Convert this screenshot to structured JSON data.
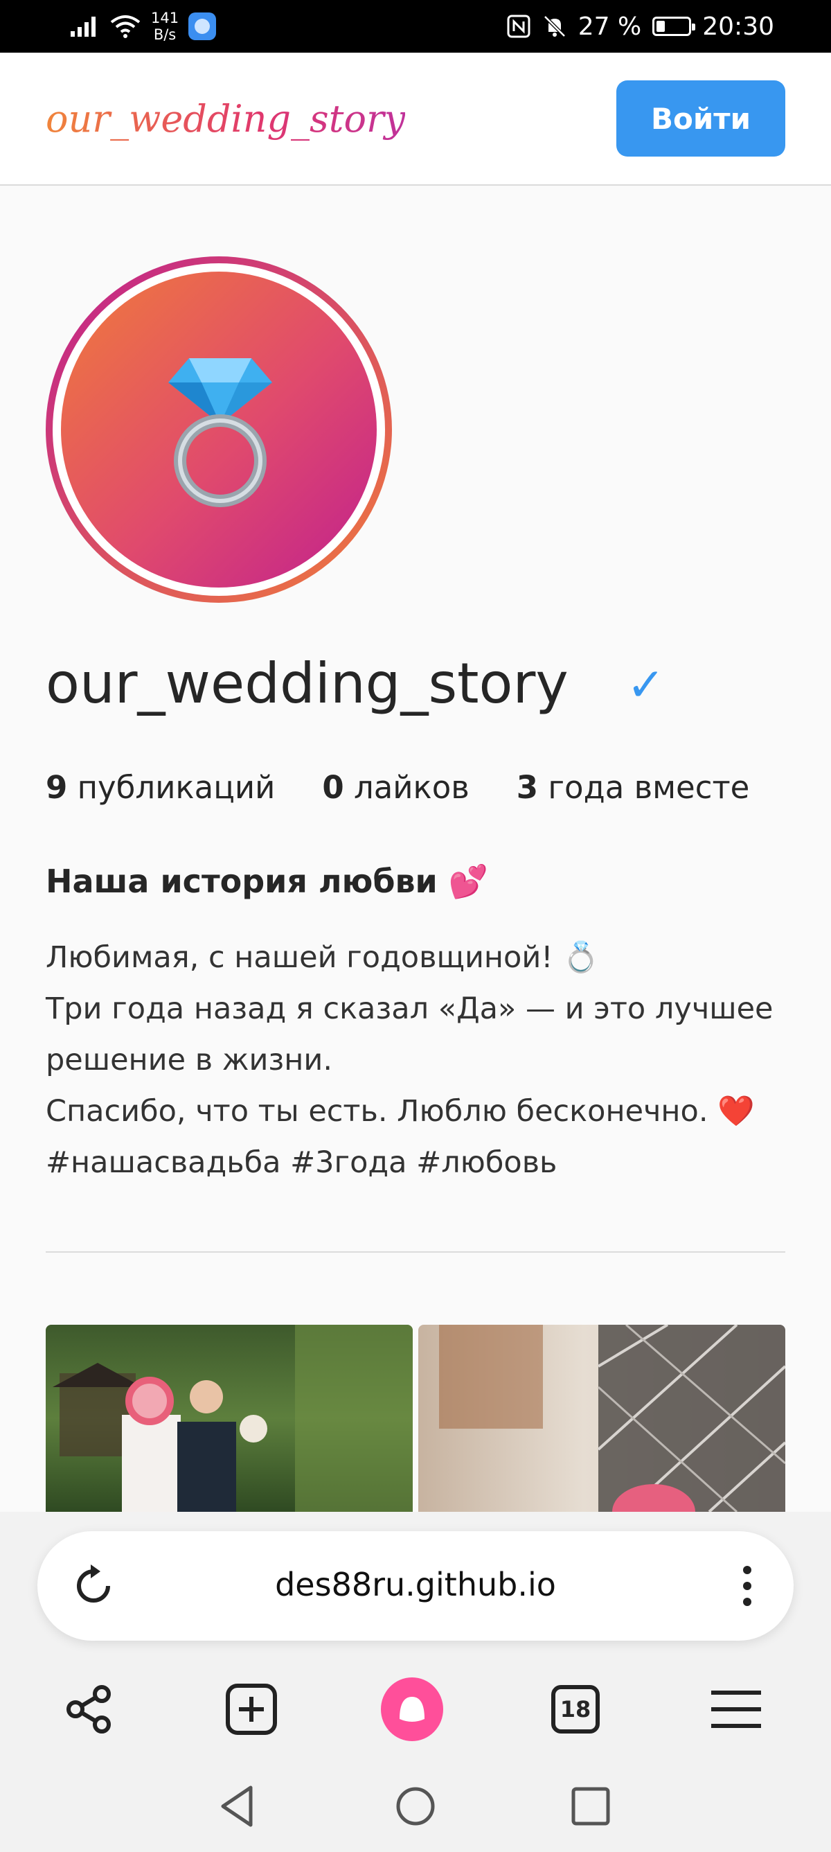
{
  "status_bar": {
    "net_speed_value": "141",
    "net_speed_unit": "B/s",
    "battery": "27 %",
    "battery_level": 0.27,
    "time": "20:30"
  },
  "header": {
    "logo": "our_wedding_story",
    "login_label": "Войти"
  },
  "profile": {
    "username": "our_wedding_story",
    "verified_mark": "✓",
    "stats": [
      {
        "value": "9",
        "label": "публикаций"
      },
      {
        "value": "0",
        "label": "лайков"
      },
      {
        "value": "3",
        "label": "года вместе"
      }
    ],
    "bio_title": "Наша история любви 💕",
    "bio_lines": [
      "Любимая, с нашей годовщиной! 💍",
      "Три года назад я сказал «Да» — и это лучшее",
      "решение в жизни.",
      "Спасибо, что ты есть. Люблю бесконечно. ❤️",
      "#нашасвадьба #3года #любовь"
    ]
  },
  "browser": {
    "url": "des88ru.github.io",
    "tabs_count": "18"
  },
  "colors": {
    "accent": "#3897f0",
    "gradient_start": "#f07b3b",
    "gradient_end": "#c0208e",
    "alice": "#ff4f9a"
  },
  "icons": [
    "signal-icon",
    "wifi-icon",
    "nfc-icon",
    "bell-off-icon",
    "battery-icon",
    "ring-icon",
    "reload-icon",
    "more-icon",
    "share-icon",
    "new-tab-icon",
    "alice-icon",
    "tabs-icon",
    "menu-icon",
    "back-icon",
    "home-icon",
    "recents-icon"
  ]
}
